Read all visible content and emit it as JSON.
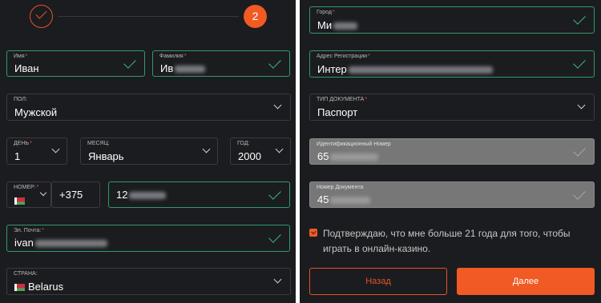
{
  "stepper": {
    "current_step": "2"
  },
  "form": {
    "first_name": {
      "label": "Имя",
      "value": "Иван"
    },
    "last_name": {
      "label": "Фамилия",
      "value": "Ив"
    },
    "gender": {
      "label": "ПОЛ:",
      "value": "Мужской"
    },
    "day": {
      "label": "ДЕНЬ",
      "value": "1"
    },
    "month": {
      "label": "МЕСЯЦ:",
      "value": "Январь"
    },
    "year": {
      "label": "ГОД:",
      "value": "2000"
    },
    "phone_code": {
      "label": "НОМЕР:",
      "prefix": "+375"
    },
    "phone_number": {
      "value": "12"
    },
    "email": {
      "label": "Эл. Почта:",
      "value": "ivan"
    },
    "country": {
      "label": "СТРАНА:",
      "value": "Belarus"
    },
    "city": {
      "label": "Город",
      "value": "Ми"
    },
    "address": {
      "label": "Адрес Регистрации",
      "value": "Интер"
    },
    "doc_type": {
      "label": "ТИП ДОКУМЕНТА",
      "value": "Паспорт"
    },
    "id_number": {
      "label": "Идентификационный Номер",
      "value": "65"
    },
    "doc_number": {
      "label": "Номер Документа",
      "value": "45"
    }
  },
  "consent": {
    "text": "Подтверждаю, что мне больше 21 года для того, чтобы играть в онлайн-казино."
  },
  "buttons": {
    "back_label": "Назад",
    "next_label": "Далее"
  },
  "colors": {
    "accent": "#f15a24",
    "valid_border": "#2e9b6c",
    "panel_bg": "#1b1c1f"
  }
}
